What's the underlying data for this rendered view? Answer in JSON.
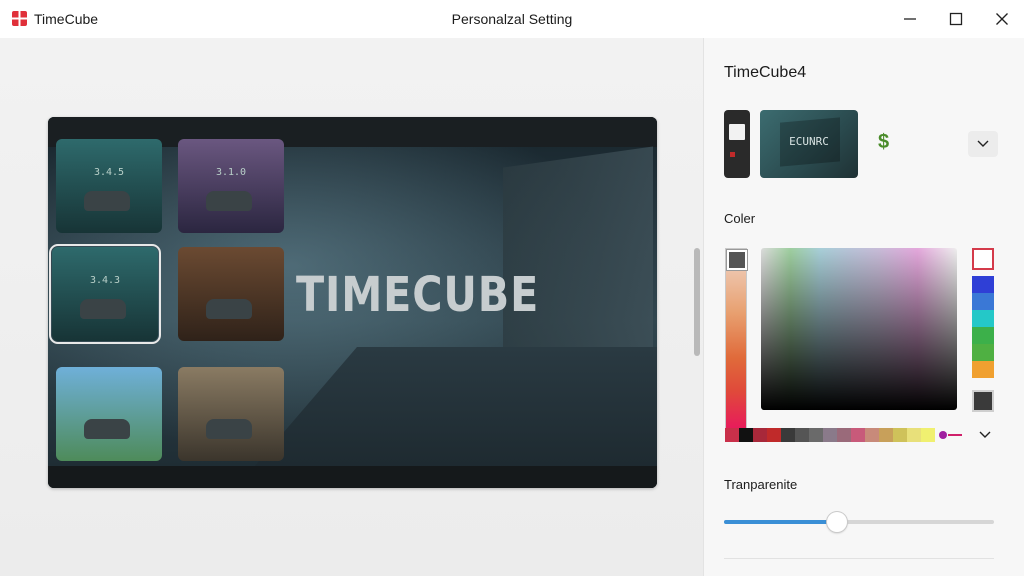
{
  "window": {
    "app_name": "TimeCube",
    "title": "Personalzal Setting"
  },
  "preview": {
    "title_text": "TIMECUBE",
    "thumbnails": [
      {
        "label": "3.4.5",
        "selected": false,
        "colors": [
          "#2e6a6c",
          "#173436"
        ]
      },
      {
        "label": "3.1.0",
        "selected": false,
        "colors": [
          "#6a5780",
          "#2b2640"
        ]
      },
      {
        "label": "3.4.3",
        "selected": true,
        "colors": [
          "#2e6a6c",
          "#173436"
        ]
      },
      {
        "label": "",
        "selected": false,
        "colors": [
          "#6b4a32",
          "#2f2219"
        ]
      },
      {
        "label": "",
        "selected": false,
        "colors": [
          "#6fb0d9",
          "#4e8b5a"
        ]
      },
      {
        "label": "",
        "selected": false,
        "colors": [
          "#8a7b63",
          "#3b352c"
        ]
      }
    ]
  },
  "panel": {
    "title": "TimeCube4",
    "preview_thumb_text": "ECUNRC",
    "dollar_symbol": "$",
    "color_label": "Coler",
    "transparency_label": "Tranparenite",
    "transparency_value": 0.42
  },
  "palette_swatches": [
    "#c9304a",
    "#111111",
    "#a8283a",
    "#c02a2a",
    "#3a3a3a",
    "#555555",
    "#6a6a6a",
    "#8a7a8a",
    "#9a6a7a",
    "#c85a7a",
    "#c88a7a",
    "#c8a05a",
    "#cfc25a",
    "#e8e07a",
    "#f0f070"
  ],
  "side_swatches": [
    "#2f3fd6",
    "#3a78d6",
    "#24c8c8",
    "#3cb04a",
    "#4fb042",
    "#f0a030"
  ],
  "side_bottom_swatch": "#3a3a3a",
  "picker_color": "#a020a0",
  "icons": {
    "app": "timecube-logo-icon",
    "minimize": "minimize-icon",
    "maximize": "maximize-icon",
    "close": "close-icon",
    "dropdown": "chevron-down-icon",
    "phone": "phone-icon",
    "dollar": "dollar-icon"
  }
}
